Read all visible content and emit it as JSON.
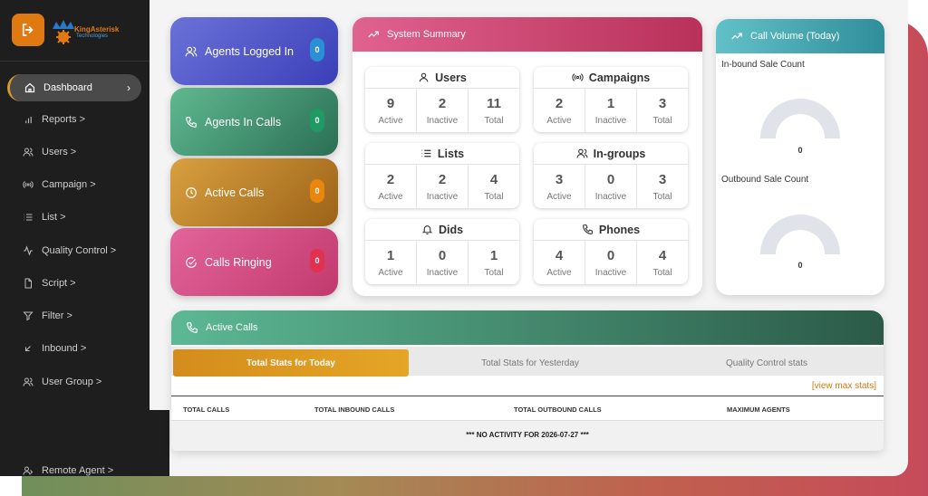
{
  "brand": {
    "name": "KingAsterisk",
    "sub": "Technologies"
  },
  "sidebar": {
    "items": [
      {
        "label": "Dashboard",
        "icon": "home-icon"
      },
      {
        "label": "Reports >",
        "icon": "bar-chart-icon"
      },
      {
        "label": "Users >",
        "icon": "users-icon"
      },
      {
        "label": "Campaign >",
        "icon": "broadcast-icon"
      },
      {
        "label": "List >",
        "icon": "list-icon"
      },
      {
        "label": "Quality Control >",
        "icon": "activity-icon"
      },
      {
        "label": "Script >",
        "icon": "document-icon"
      },
      {
        "label": "Filter >",
        "icon": "filter-icon"
      },
      {
        "label": "Inbound >",
        "icon": "inbound-arrow-icon"
      },
      {
        "label": "User Group >",
        "icon": "user-group-icon"
      },
      {
        "label": "Remote Agent >",
        "icon": "remote-user-icon"
      }
    ],
    "dashboard_chevron": "›"
  },
  "stats": [
    {
      "label": "Agents Logged In",
      "value": "0",
      "icon": "users-icon",
      "color": "#5b5fd0"
    },
    {
      "label": "Agents In Calls",
      "value": "0",
      "icon": "phone-icon",
      "color": "#3f9f7f"
    },
    {
      "label": "Active Calls",
      "value": "0",
      "icon": "clock-icon",
      "color": "#c8882d"
    },
    {
      "label": "Calls Ringing",
      "value": "0",
      "icon": "check-circle-icon",
      "color": "#d9508a"
    }
  ],
  "summary": {
    "title": "System Summary",
    "groups": [
      {
        "title": "Users",
        "icon": "user-icon",
        "active": "9",
        "inactive": "2",
        "total": "11"
      },
      {
        "title": "Campaigns",
        "icon": "broadcast-icon",
        "active": "2",
        "inactive": "1",
        "total": "3"
      },
      {
        "title": "Lists",
        "icon": "list-icon",
        "active": "2",
        "inactive": "2",
        "total": "4"
      },
      {
        "title": "In-groups",
        "icon": "users-icon",
        "active": "3",
        "inactive": "0",
        "total": "3"
      },
      {
        "title": "Dids",
        "icon": "bell-icon",
        "active": "1",
        "inactive": "0",
        "total": "1"
      },
      {
        "title": "Phones",
        "icon": "phone-icon",
        "active": "4",
        "inactive": "0",
        "total": "4"
      }
    ],
    "labels": {
      "active": "Active",
      "inactive": "Inactive",
      "total": "Total"
    }
  },
  "volume": {
    "title": "Call Volume (Today)",
    "inbound_label": "In-bound Sale Count",
    "inbound_value": "0",
    "outbound_label": "Outbound Sale Count",
    "outbound_value": "0"
  },
  "active_calls": {
    "title": "Active Calls",
    "tabs": [
      "Total Stats for Today",
      "Total Stats for Yesterday",
      "Quality Control stats"
    ],
    "view_max": "[view max stats]",
    "columns": [
      "TOTAL CALLS",
      "TOTAL INBOUND CALLS",
      "TOTAL OUTBOUND CALLS",
      "MAXIMUM AGENTS"
    ],
    "empty": "*** NO ACTIVITY FOR 2026-07-27 ***"
  },
  "colors": {
    "accent": "#e07a10",
    "summary_header": "#d9508a",
    "volume_header": "#3aa6b0",
    "active_header": "#2f7a60"
  }
}
